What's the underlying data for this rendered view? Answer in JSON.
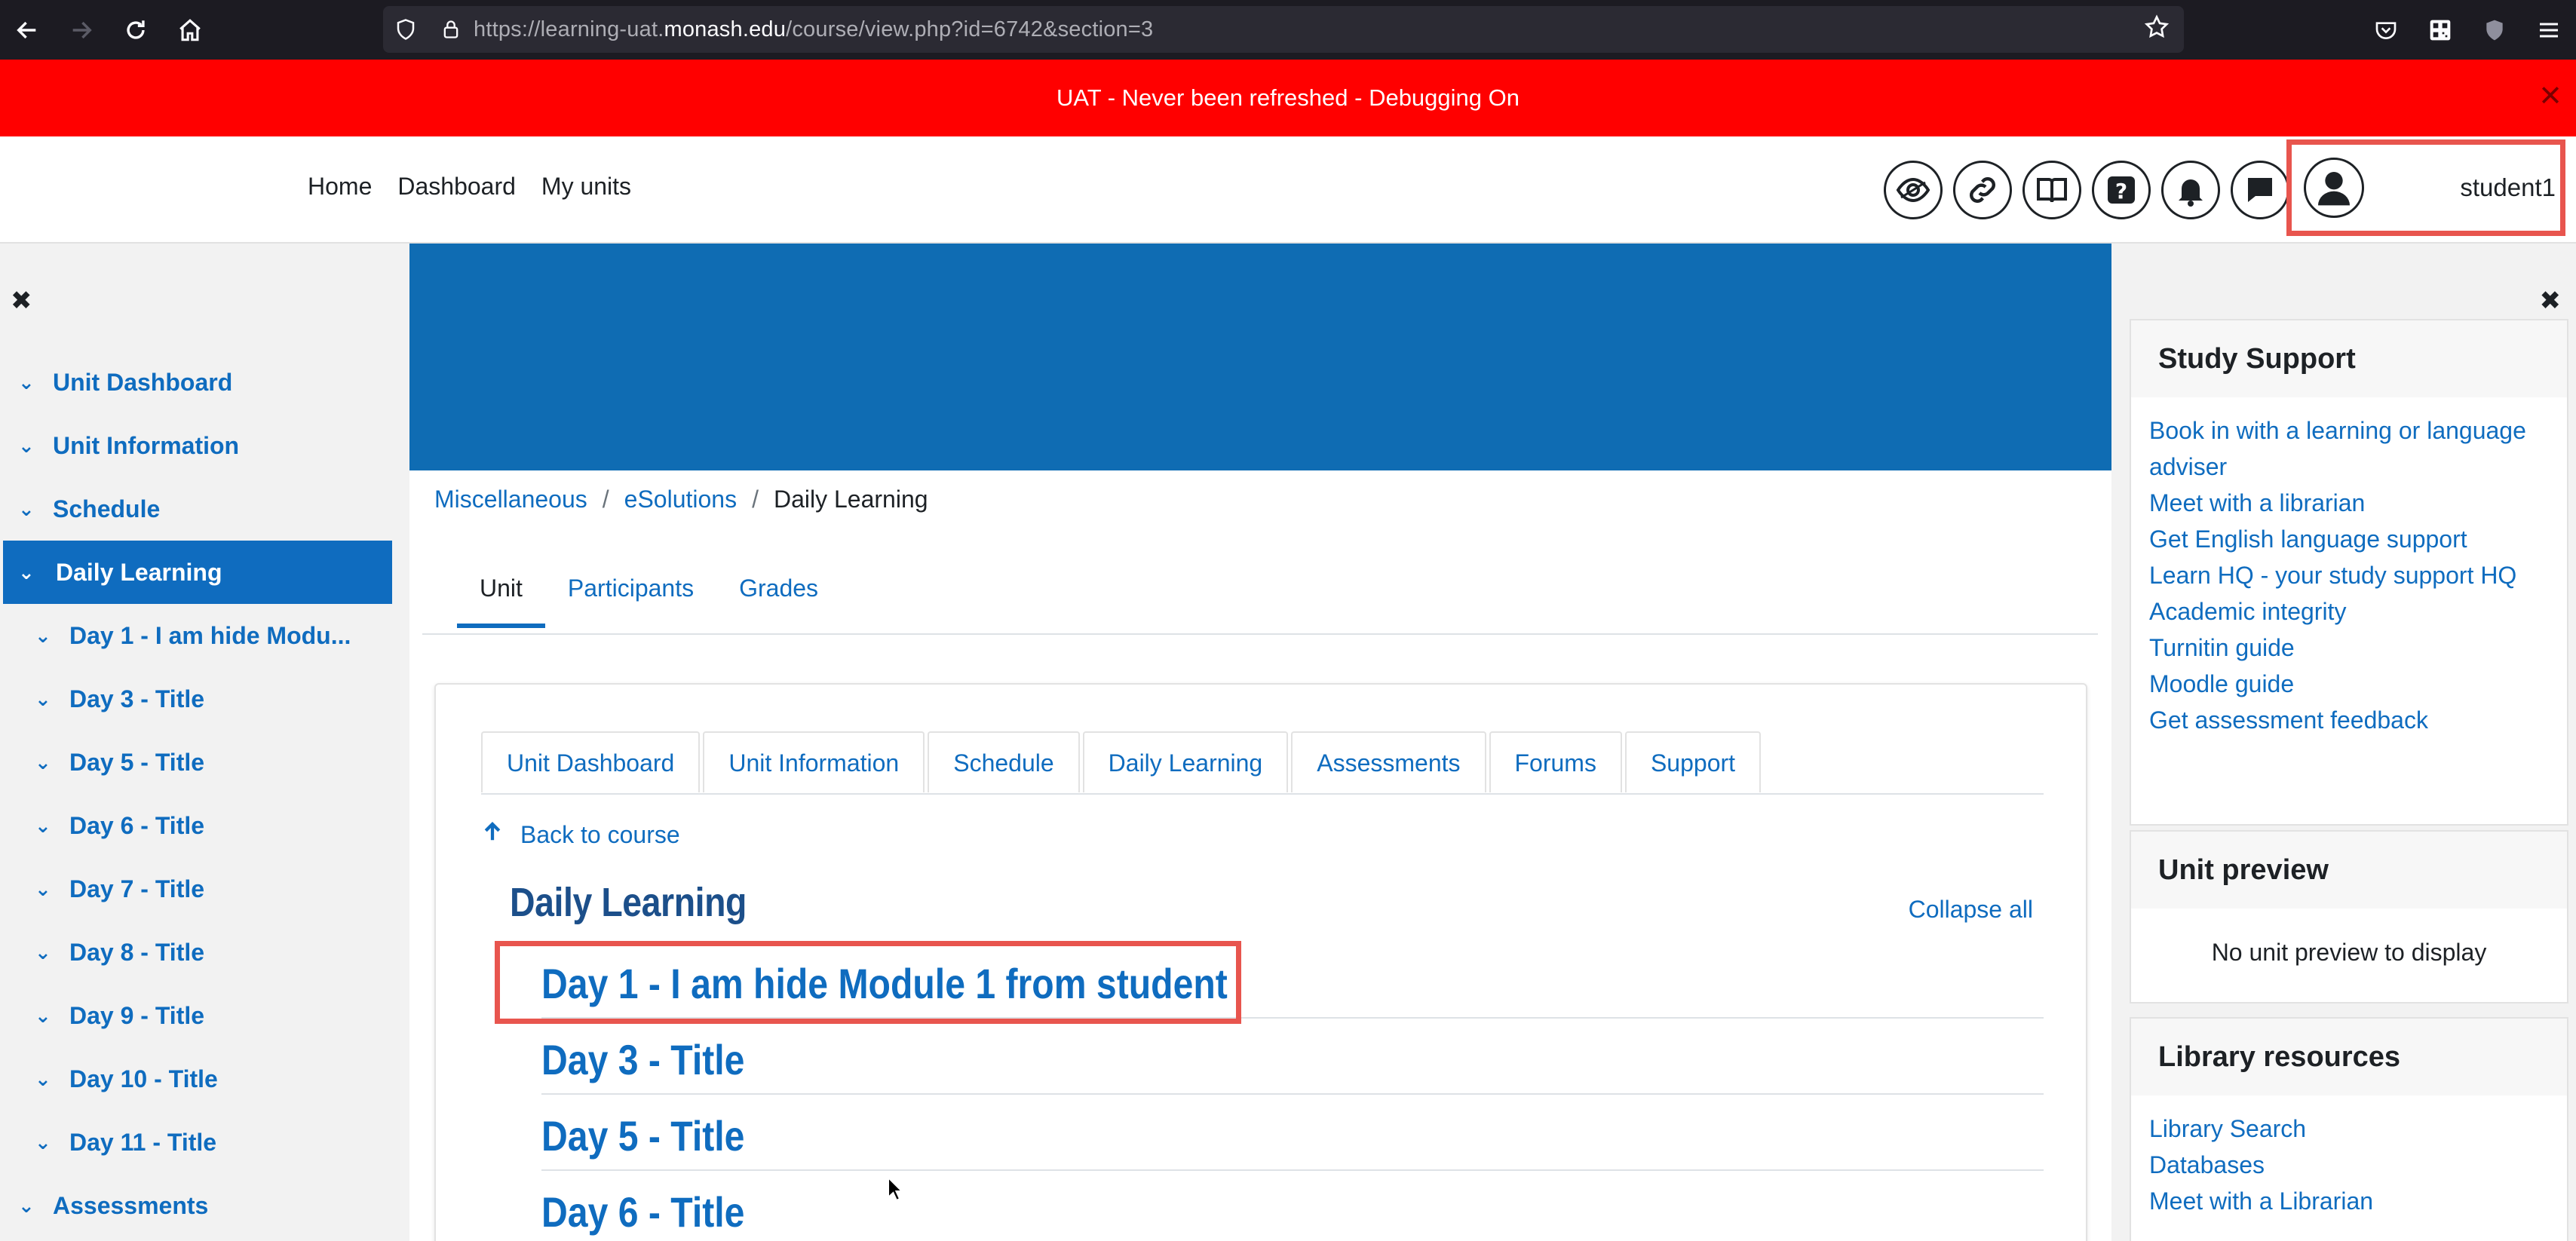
{
  "browser": {
    "url_prefix": "https://learning-uat.",
    "url_domain": "monash.edu",
    "url_suffix": "/course/view.php?id=6742&section=3"
  },
  "banner": {
    "text": "UAT - Never been refreshed - Debugging On",
    "close": "✕"
  },
  "navbar": {
    "links": [
      "Home",
      "Dashboard",
      "My units"
    ],
    "username": "student1"
  },
  "left_nav": {
    "close": "✖",
    "items": [
      {
        "label": "Unit Dashboard"
      },
      {
        "label": "Unit Information"
      },
      {
        "label": "Schedule"
      },
      {
        "label": "Daily Learning"
      },
      {
        "label": "Day 1 - I am hide Modu..."
      },
      {
        "label": "Day 3 - Title"
      },
      {
        "label": "Day 5 - Title"
      },
      {
        "label": "Day 6 - Title"
      },
      {
        "label": "Day 7 - Title"
      },
      {
        "label": "Day 8 - Title"
      },
      {
        "label": "Day 9 - Title"
      },
      {
        "label": "Day 10 - Title"
      },
      {
        "label": "Day 11 - Title"
      },
      {
        "label": "Assessments"
      }
    ]
  },
  "breadcrumb": {
    "items": [
      "Miscellaneous",
      "eSolutions"
    ],
    "current": "Daily Learning",
    "sep": "/"
  },
  "course_tabs": [
    "Unit",
    "Participants",
    "Grades"
  ],
  "section_tabs": [
    "Unit Dashboard",
    "Unit Information",
    "Schedule",
    "Daily Learning",
    "Assessments",
    "Forums",
    "Support"
  ],
  "main": {
    "back_label": "Back to course",
    "section_title": "Daily Learning",
    "collapse_label": "Collapse all",
    "days": [
      "Day 1 - I am hide Module 1 from student",
      "Day 3 - Title",
      "Day 5 - Title",
      "Day 6 - Title"
    ]
  },
  "right": {
    "close": "✖",
    "study_support": {
      "title": "Study Support",
      "links": [
        "Book in with a learning or language adviser",
        "Meet with a librarian",
        "Get English language support",
        "Learn HQ - your study support HQ",
        "Academic integrity",
        "Turnitin guide",
        "Moodle guide",
        "Get assessment feedback"
      ]
    },
    "unit_preview": {
      "title": "Unit preview",
      "text": "No unit preview to display"
    },
    "library": {
      "title": "Library resources",
      "links": [
        "Library Search",
        "Databases",
        "Meet with a Librarian"
      ]
    }
  }
}
